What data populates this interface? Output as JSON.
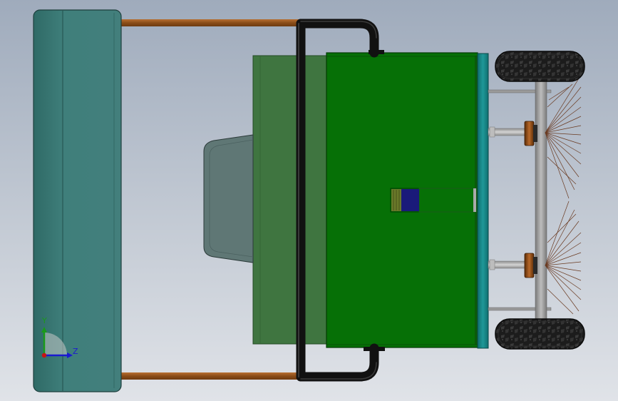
{
  "viewport": {
    "background_top": "#9fabbc",
    "background_bottom": "#e0e3e8"
  },
  "triad": {
    "y_label": "Y",
    "z_label": "Z",
    "y_color": "#1a9a1a",
    "z_color": "#1a1ad0",
    "x_color": "#c81414"
  },
  "colors": {
    "hopper": "#3f7f7b",
    "rods": "#9a5a22",
    "frame_tube": "#1a1a1a",
    "rear_body": "#3f7540",
    "front_body": "#067006",
    "seat": "#5f7775",
    "front_plate": "#1a8c8c",
    "axle": "#9a9a9a",
    "wheels": "#202020",
    "brush_hub": "#8a4a10",
    "bristles": "#6a3a20",
    "indicator": "#1a1a7a"
  }
}
